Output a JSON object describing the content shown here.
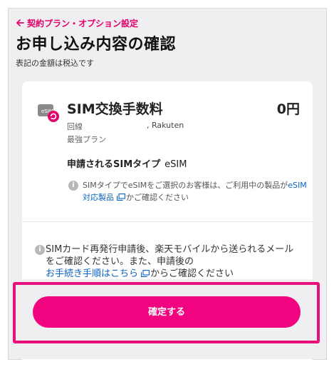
{
  "header": {
    "back_label": "契約プラン・オプション設定",
    "title": "お申し込み内容の確認",
    "tax_note": "表記の金額は税込です"
  },
  "item": {
    "name": "SIM交換手数料",
    "price": "0円",
    "line_label": "回線",
    "line_value": ", Rakuten",
    "plan": "最強プラン",
    "sim_type_label": "申請されるSIMタイプ",
    "sim_type_value": "eSIM",
    "info_text_1": "SIMタイプでeSIMをご選択のお客様は、ご利用中の製品が",
    "info_link": "eSIM対応製品",
    "info_text_2": "かご確認ください"
  },
  "notice": {
    "text_1": "SIMカード再発行申請後、楽天モバイルから送られるメールをご確認ください。また、申請後の",
    "link": "お手続き手順はこちら",
    "text_2": "からご確認ください"
  },
  "actions": {
    "confirm_label": "確定する"
  },
  "colors": {
    "accent": "#e4006b",
    "button": "#f0047f",
    "highlight": "#ea0f7d",
    "link": "#0b63c1"
  }
}
